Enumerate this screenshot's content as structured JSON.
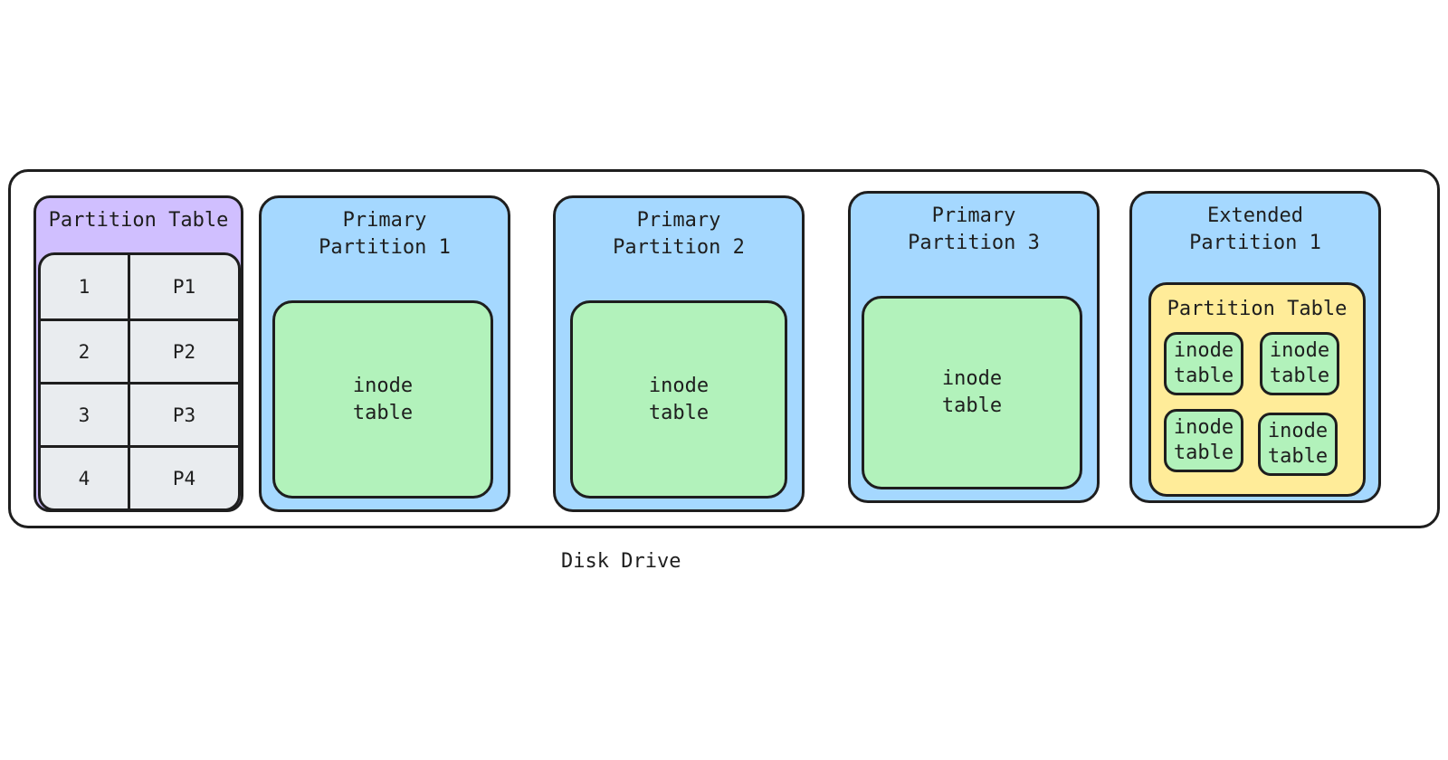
{
  "diagram": {
    "caption": "Disk Drive",
    "partition_table": {
      "title": "Partition Table",
      "rows": [
        {
          "index": "1",
          "partition": "P1"
        },
        {
          "index": "2",
          "partition": "P2"
        },
        {
          "index": "3",
          "partition": "P3"
        },
        {
          "index": "4",
          "partition": "P4"
        }
      ]
    },
    "partitions": [
      {
        "title": "Primary\nPartition 1",
        "content": "inode\ntable"
      },
      {
        "title": "Primary\nPartition 2",
        "content": "inode\ntable"
      },
      {
        "title": "Primary\nPartition 3",
        "content": "inode\ntable"
      }
    ],
    "extended_partition": {
      "title": "Extended\nPartition 1",
      "partition_table_title": "Partition Table",
      "inode_tables": [
        "inode\ntable",
        "inode\ntable",
        "inode\ntable",
        "inode\ntable"
      ]
    },
    "colors": {
      "partition_table": "#d0bfff",
      "table_cells": "#e9ecef",
      "partition": "#a5d8ff",
      "inode_table": "#b2f2bb",
      "extended_partition_table": "#ffec99",
      "stroke": "#1e1e1e"
    }
  }
}
